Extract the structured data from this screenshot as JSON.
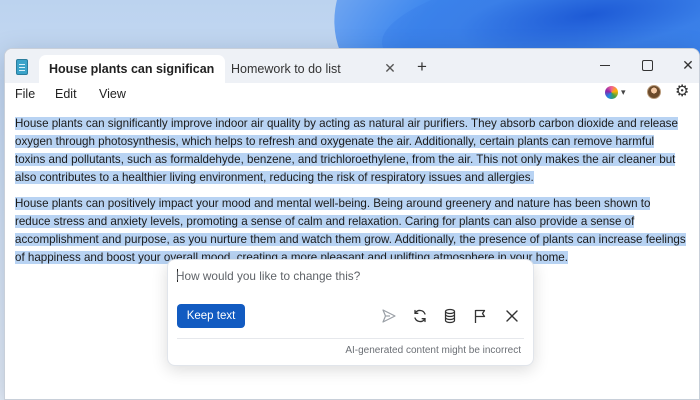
{
  "window": {
    "tabs": [
      {
        "label": "House plants can significan",
        "active": true
      },
      {
        "label": "Homework to do list",
        "active": false
      }
    ],
    "new_tab_symbol": "+",
    "close_symbol": "✕"
  },
  "menu": {
    "items": [
      "File",
      "Edit",
      "View"
    ]
  },
  "document": {
    "paragraphs": [
      "House plants can significantly improve indoor air quality by acting as natural air purifiers. They absorb carbon dioxide and release oxygen through photosynthesis, which helps to refresh and oxygenate the air. Additionally, certain plants can remove harmful toxins and pollutants, such as formaldehyde, benzene, and trichloroethylene, from the air. This not only makes the air cleaner but also contributes to a healthier living environment, reducing the risk of respiratory issues and allergies.",
      "House plants can positively impact your mood and mental well-being. Being around greenery and nature has been shown to reduce stress and anxiety levels, promoting a sense of calm and relaxation. Caring for plants can also provide a sense of accomplishment and purpose, as you nurture them and watch them grow. Additionally, the presence of plants can increase feelings of happiness and boost your overall mood, creating a more pleasant and uplifting atmosphere in your home."
    ],
    "selection_color": "#b8d3f3"
  },
  "rewrite_popup": {
    "placeholder": "How would you like to change this?",
    "keep_label": "Keep text",
    "disclaimer": "AI-generated content might be incorrect",
    "accent": "#125bc1",
    "icons": [
      "send-icon",
      "retry-icon",
      "versions-icon",
      "flag-icon",
      "close-icon"
    ]
  }
}
